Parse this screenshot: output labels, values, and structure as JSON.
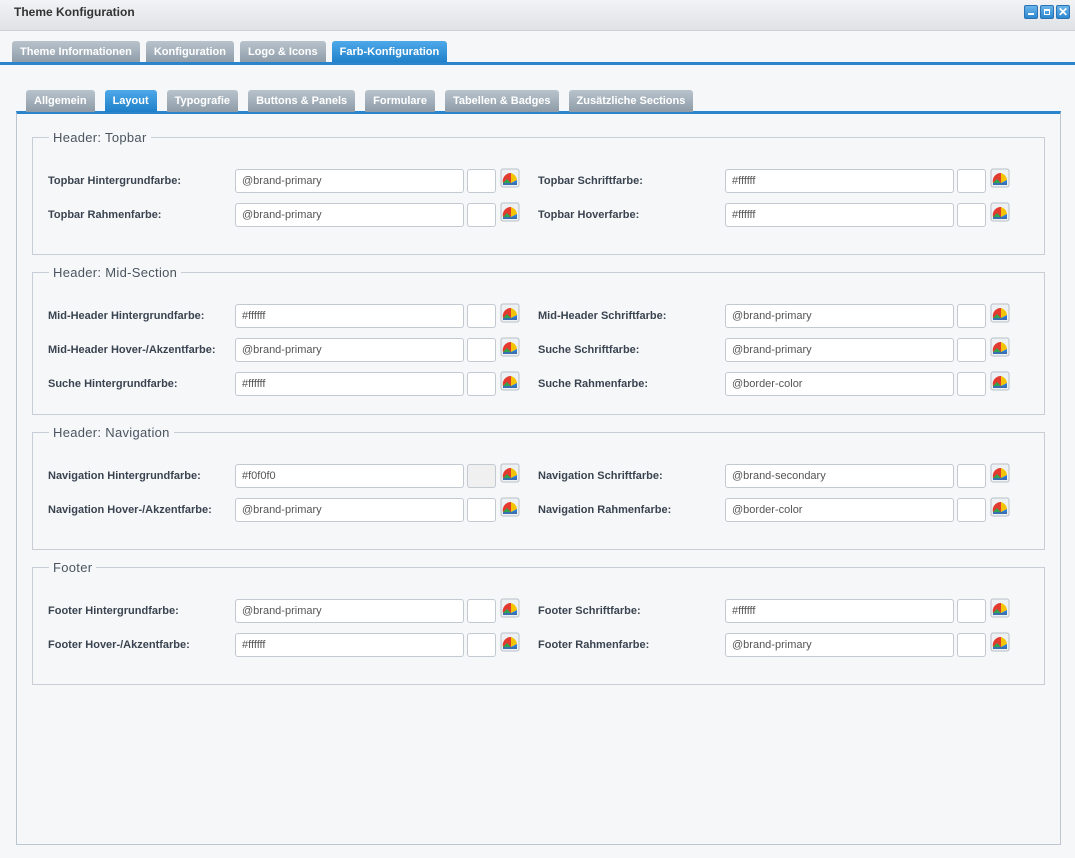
{
  "window": {
    "title": "Theme Konfiguration"
  },
  "outer_tabs": [
    {
      "label": "Theme Informationen",
      "active": false
    },
    {
      "label": "Konfiguration",
      "active": false
    },
    {
      "label": "Logo & Icons",
      "active": false
    },
    {
      "label": "Farb-Konfiguration",
      "active": true
    }
  ],
  "inner_tabs": [
    {
      "label": "Allgemein",
      "active": false
    },
    {
      "label": "Layout",
      "active": true
    },
    {
      "label": "Typografie",
      "active": false
    },
    {
      "label": "Buttons & Panels",
      "active": false
    },
    {
      "label": "Formulare",
      "active": false
    },
    {
      "label": "Tabellen & Badges",
      "active": false
    },
    {
      "label": "Zusätzliche Sections",
      "active": false
    }
  ],
  "sections": [
    {
      "title": "Header: Topbar",
      "rows": [
        [
          {
            "label": "Topbar Hintergrundfarbe:",
            "value": "@brand-primary",
            "swatch": "#ffffff"
          },
          {
            "label": "Topbar Schriftfarbe:",
            "value": "#ffffff",
            "swatch": "#ffffff"
          }
        ],
        [
          {
            "label": "Topbar Rahmenfarbe:",
            "value": "@brand-primary",
            "swatch": "#ffffff"
          },
          {
            "label": "Topbar Hoverfarbe:",
            "value": "#ffffff",
            "swatch": "#ffffff"
          }
        ]
      ]
    },
    {
      "title": "Header: Mid-Section",
      "rows": [
        [
          {
            "label": "Mid-Header Hintergrundfarbe:",
            "value": "#ffffff",
            "swatch": "#ffffff"
          },
          {
            "label": "Mid-Header Schriftfarbe:",
            "value": "@brand-primary",
            "swatch": "#ffffff"
          }
        ],
        [
          {
            "label": "Mid-Header Hover-/Akzentfarbe:",
            "value": "@brand-primary",
            "swatch": "#ffffff"
          },
          {
            "label": "Suche Schriftfarbe:",
            "value": "@brand-primary",
            "swatch": "#ffffff"
          }
        ],
        [
          {
            "label": "Suche Hintergrundfarbe:",
            "value": "#ffffff",
            "swatch": "#ffffff"
          },
          {
            "label": "Suche Rahmenfarbe:",
            "value": "@border-color",
            "swatch": "#ffffff"
          }
        ]
      ]
    },
    {
      "title": "Header: Navigation",
      "rows": [
        [
          {
            "label": "Navigation Hintergrundfarbe:",
            "value": "#f0f0f0",
            "swatch": "#f0f0f0"
          },
          {
            "label": "Navigation Schriftfarbe:",
            "value": "@brand-secondary",
            "swatch": "#ffffff"
          }
        ],
        [
          {
            "label": "Navigation Hover-/Akzentfarbe:",
            "value": "@brand-primary",
            "swatch": "#ffffff"
          },
          {
            "label": "Navigation Rahmenfarbe:",
            "value": "@border-color",
            "swatch": "#ffffff"
          }
        ]
      ]
    },
    {
      "title": "Footer",
      "rows": [
        [
          {
            "label": "Footer Hintergrundfarbe:",
            "value": "@brand-primary",
            "swatch": "#ffffff"
          },
          {
            "label": "Footer Schriftfarbe:",
            "value": "#ffffff",
            "swatch": "#ffffff"
          }
        ],
        [
          {
            "label": "Footer Hover-/Akzentfarbe:",
            "value": "#ffffff",
            "swatch": "#ffffff"
          },
          {
            "label": "Footer Rahmenfarbe:",
            "value": "@brand-primary",
            "swatch": "#ffffff"
          }
        ]
      ]
    }
  ],
  "icons": {
    "minimize": "minimize-icon",
    "maximize": "maximize-icon",
    "close": "close-icon",
    "color_picker": "color-picker-icon"
  },
  "colors": {
    "accent": "#2a85cc",
    "tab_inactive": "#9aa7b2"
  }
}
